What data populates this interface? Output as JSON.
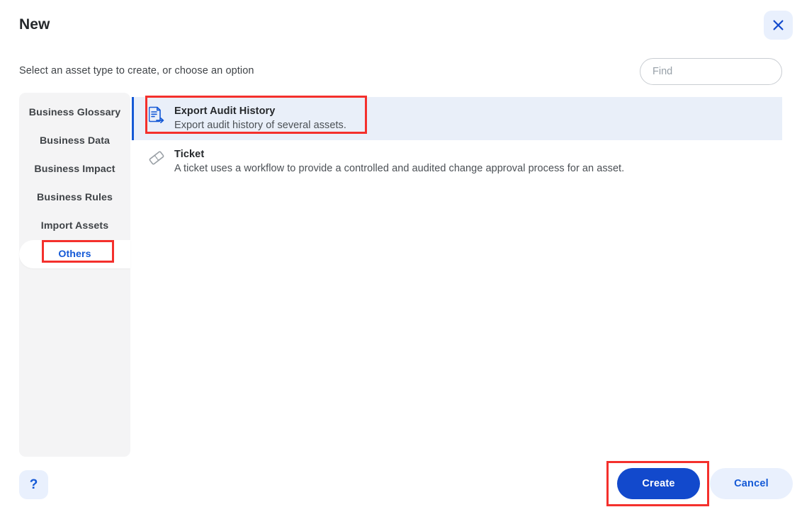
{
  "header": {
    "title": "New",
    "close_icon": "close-icon"
  },
  "subtitle": "Select an asset type to create, or choose an option",
  "search": {
    "placeholder": "Find",
    "value": ""
  },
  "categories": [
    {
      "label": "Business Glossary",
      "selected": false
    },
    {
      "label": "Business Data",
      "selected": false
    },
    {
      "label": "Business Impact",
      "selected": false
    },
    {
      "label": "Business Rules",
      "selected": false
    },
    {
      "label": "Import Assets",
      "selected": false
    },
    {
      "label": "Others",
      "selected": true
    }
  ],
  "results": [
    {
      "icon": "export-document-icon",
      "title": "Export Audit History",
      "description": "Export audit history of several assets.",
      "selected": true
    },
    {
      "icon": "ticket-icon",
      "title": "Ticket",
      "description": "A ticket uses a workflow to provide a controlled and audited change approval process for an asset.",
      "selected": false
    }
  ],
  "footer": {
    "help_label": "?",
    "create_label": "Create",
    "cancel_label": "Cancel"
  },
  "colors": {
    "accent_blue": "#1459d6",
    "primary_button": "#1249cc",
    "selected_row_bg": "#e9eff9",
    "light_blue_bg": "#e9f0fd",
    "sidebar_bg": "#f4f4f5",
    "annotation_red": "#f4302c"
  }
}
